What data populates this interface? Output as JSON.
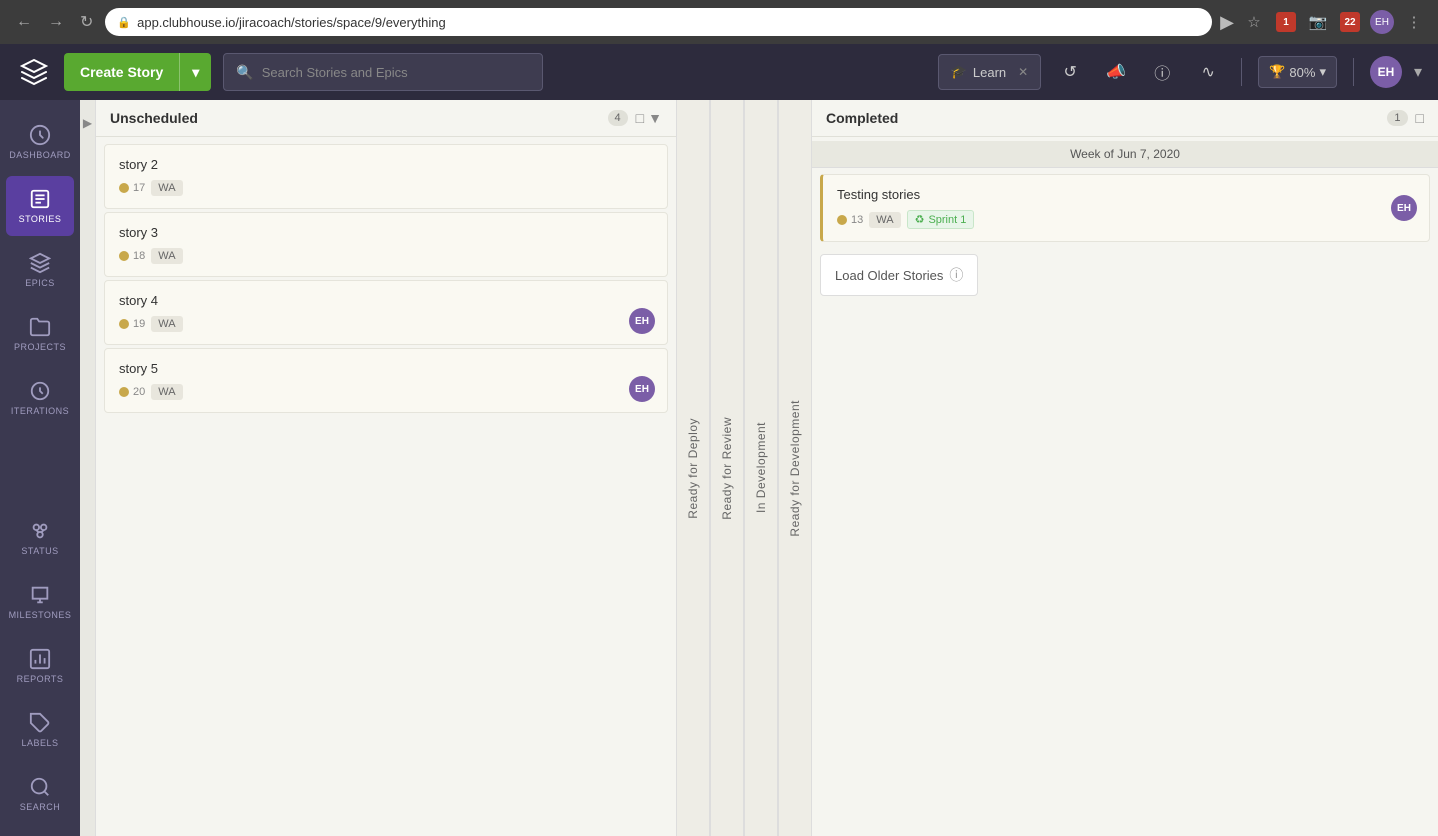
{
  "browser": {
    "url": "app.clubhouse.io/jiracoach/stories/space/9/everything",
    "back_label": "←",
    "forward_label": "→",
    "refresh_label": "↺"
  },
  "header": {
    "create_story_label": "Create Story",
    "search_placeholder": "Search Stories and Epics",
    "learn_label": "Learn",
    "score_label": "80%",
    "avatar_label": "EH"
  },
  "sidebar": {
    "items": [
      {
        "id": "dashboard",
        "label": "Dashboard",
        "icon": "dashboard"
      },
      {
        "id": "stories",
        "label": "Stories",
        "icon": "stories",
        "active": true
      },
      {
        "id": "epics",
        "label": "Epics",
        "icon": "epics"
      },
      {
        "id": "projects",
        "label": "Projects",
        "icon": "projects"
      },
      {
        "id": "iterations",
        "label": "Iterations",
        "icon": "iterations"
      },
      {
        "id": "status",
        "label": "Status",
        "icon": "status"
      },
      {
        "id": "milestones",
        "label": "Milestones",
        "icon": "milestones"
      },
      {
        "id": "reports",
        "label": "Reports",
        "icon": "reports"
      },
      {
        "id": "labels",
        "label": "Labels",
        "icon": "labels"
      },
      {
        "id": "search",
        "label": "Search",
        "icon": "search"
      }
    ]
  },
  "board": {
    "columns": {
      "unscheduled": {
        "title": "Unscheduled",
        "count": "4"
      },
      "vertical_labels": [
        "Ready for Deploy",
        "Ready for Review",
        "In Development",
        "Ready for Development"
      ],
      "completed": {
        "title": "Completed",
        "count": "1",
        "week_label": "Week of Jun 7, 2020"
      }
    },
    "unscheduled_stories": [
      {
        "title": "story 2",
        "id": "17",
        "label": "WA"
      },
      {
        "title": "story 3",
        "id": "18",
        "label": "WA"
      },
      {
        "title": "story 4",
        "id": "19",
        "label": "WA",
        "avatar": "EH"
      },
      {
        "title": "story 5",
        "id": "20",
        "label": "WA",
        "avatar": "EH"
      }
    ],
    "completed_stories": [
      {
        "title": "Testing stories",
        "id": "13",
        "label": "WA",
        "sprint": "Sprint 1",
        "avatar": "EH"
      }
    ],
    "load_older_label": "Load Older Stories"
  }
}
